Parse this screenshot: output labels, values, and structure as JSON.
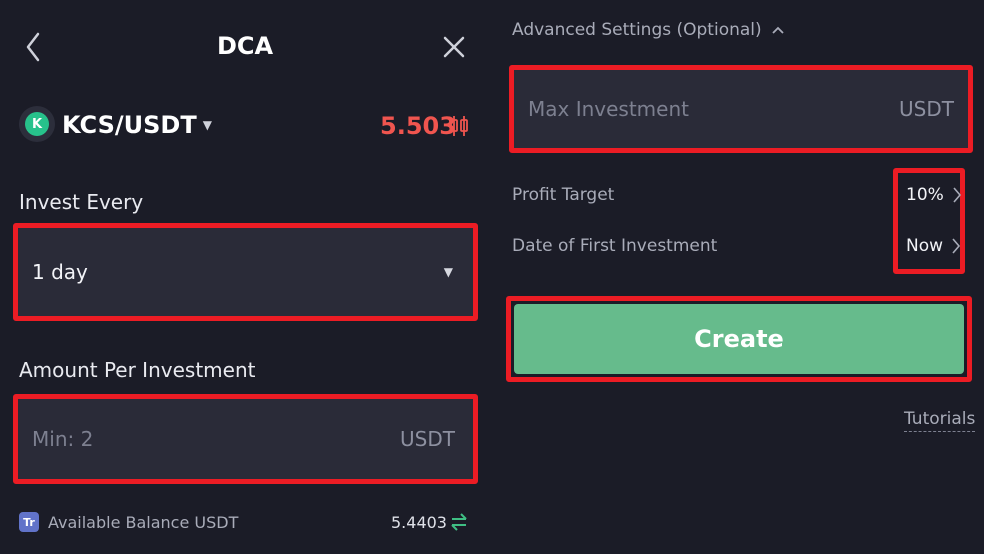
{
  "header": {
    "title": "DCA"
  },
  "pair": {
    "coin_logo_letter": "K",
    "name": "KCS/USDT",
    "price": "5.503"
  },
  "invest_every": {
    "label": "Invest Every",
    "value": "1 day"
  },
  "amount": {
    "label": "Amount Per Investment",
    "placeholder": "Min: 2",
    "unit": "USDT"
  },
  "balance": {
    "icon_text": "Tr",
    "label": "Available Balance USDT",
    "value": "5.4403"
  },
  "advanced": {
    "title": "Advanced Settings (Optional)",
    "max_investment": {
      "placeholder": "Max Investment",
      "unit": "USDT"
    },
    "profit_target": {
      "label": "Profit Target",
      "value": "10%"
    },
    "first_investment": {
      "label": "Date of First Investment",
      "value": "Now"
    }
  },
  "actions": {
    "create_label": "Create",
    "tutorials_label": "Tutorials"
  },
  "colors": {
    "background": "#1b1c27",
    "price": "#f0554f",
    "create": "#66bb8c",
    "highlight": "#ec1c24"
  },
  "icons": [
    "back-chevron-icon",
    "close-icon",
    "kcs-logo-icon",
    "dropdown-caret-icon",
    "kline-chart-icon",
    "tr-token-icon",
    "swap-icon",
    "chevron-right-icon",
    "chevron-up-icon"
  ]
}
